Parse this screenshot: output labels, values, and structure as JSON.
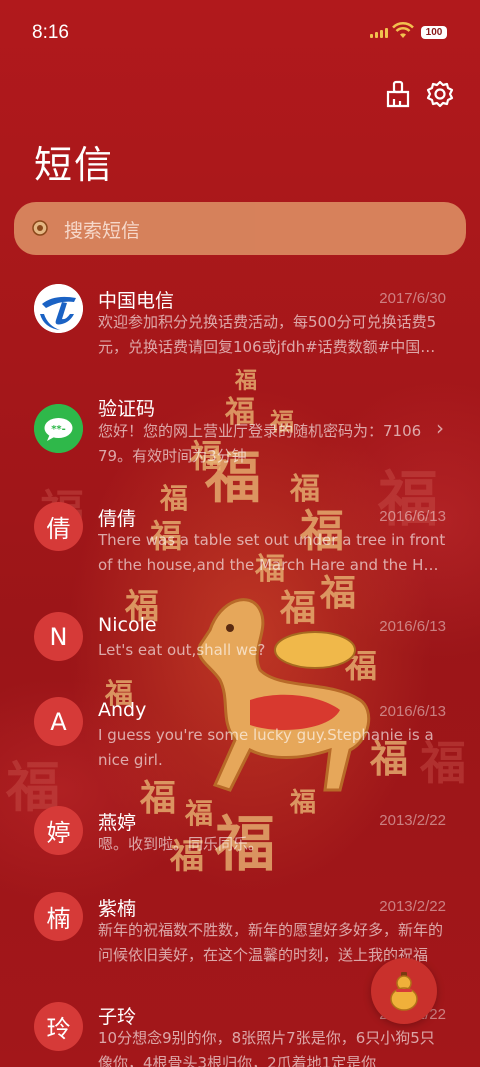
{
  "status": {
    "time": "8:16",
    "battery": "100"
  },
  "header": {
    "title": "短信"
  },
  "search": {
    "placeholder": "搜索短信"
  },
  "conversations": [
    {
      "avatar": "",
      "name": "中国电信",
      "date": "2017/6/30",
      "preview": "欢迎参加积分兑换话费活动，每500分可兑换话费5元，兑换话费请回复106或jfdh#话费数额#中国电信"
    },
    {
      "avatar": "",
      "name": "验证码",
      "date": "",
      "preview": "您好！您的网上营业厅登录的随机密码为：710679。有效时间为3分钟"
    },
    {
      "avatar": "倩",
      "name": "倩倩",
      "date": "2016/6/13",
      "preview": "There was a table set out under a tree in front of the house,and the March Hare and the Hatter"
    },
    {
      "avatar": "N",
      "name": "Nicole",
      "date": "2016/6/13",
      "preview": "Let's eat out,shall we?"
    },
    {
      "avatar": "A",
      "name": "Andy",
      "date": "2016/6/13",
      "preview": "I guess you're some lucky guy.Stephanie is a nice girl."
    },
    {
      "avatar": "婷",
      "name": "燕婷",
      "date": "2013/2/22",
      "preview": "嗯。收到啦。同乐同乐。"
    },
    {
      "avatar": "楠",
      "name": "紫楠",
      "date": "2013/2/22",
      "preview": "新年的祝福数不胜数，新年的愿望好多好多，新年的问候依旧美好，在这个温馨的时刻，送上我的祝福"
    },
    {
      "avatar": "玲",
      "name": "子玲",
      "date": "2013/2/22",
      "preview": "10分想念9别的你，8张照片7张是你，6只小狗5只像你，4根骨头3根归你，2爪着地1定是你"
    }
  ],
  "icons": {
    "clean": "broom-icon",
    "settings": "gear-icon",
    "compose": "gourd-icon"
  }
}
